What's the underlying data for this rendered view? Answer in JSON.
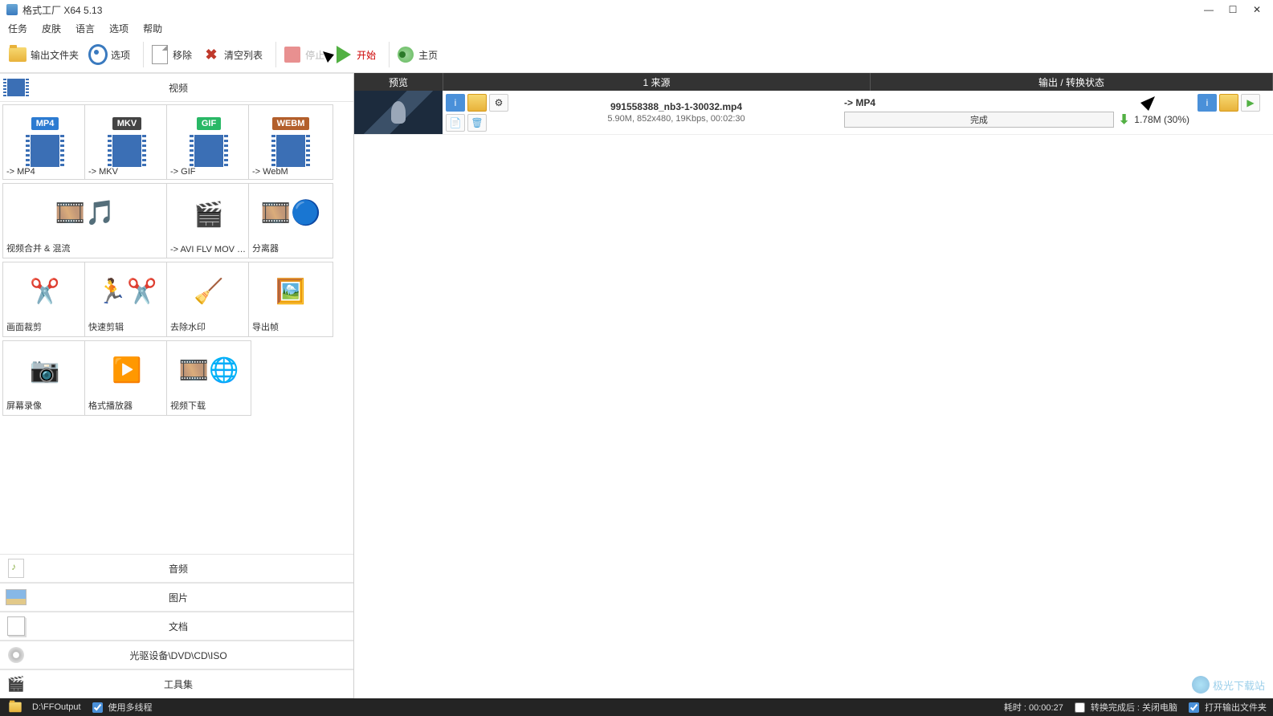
{
  "window": {
    "title": "格式工厂 X64 5.13"
  },
  "menubar": [
    "任务",
    "皮肤",
    "语言",
    "选项",
    "帮助"
  ],
  "toolbar": {
    "output_folder": "输出文件夹",
    "options": "选项",
    "remove": "移除",
    "clear_list": "清空列表",
    "stop": "停止",
    "start": "开始",
    "homepage": "主页"
  },
  "categories": {
    "video": "视频",
    "audio": "音频",
    "image": "图片",
    "document": "文档",
    "disc": "光驱设备\\DVD\\CD\\ISO",
    "tools": "工具集"
  },
  "video_tiles": [
    {
      "label": "-> MP4",
      "kind": "fmt",
      "cls": "mp4"
    },
    {
      "label": "-> MKV",
      "kind": "fmt",
      "cls": "mkv"
    },
    {
      "label": "-> GIF",
      "kind": "fmt",
      "cls": "gif"
    },
    {
      "label": "-> WebM",
      "kind": "fmt",
      "cls": "webm"
    },
    {
      "label": "视频合并 & 混流",
      "kind": "emoji",
      "icon": "🎞️🎵",
      "wide": true
    },
    {
      "label": "-> AVI FLV MOV Etc...",
      "kind": "emoji",
      "icon": "🎬"
    },
    {
      "label": "分离器",
      "kind": "emoji",
      "icon": "🎞️🔵"
    },
    {
      "label": "画面裁剪",
      "kind": "emoji",
      "icon": "✂️"
    },
    {
      "label": "快速剪辑",
      "kind": "emoji",
      "icon": "🏃✂️"
    },
    {
      "label": "去除水印",
      "kind": "emoji",
      "icon": "🧹"
    },
    {
      "label": "导出帧",
      "kind": "emoji",
      "icon": "🖼️"
    },
    {
      "label": "屏幕录像",
      "kind": "emoji",
      "icon": "📷"
    },
    {
      "label": "格式播放器",
      "kind": "emoji",
      "icon": "▶️"
    },
    {
      "label": "视频下载",
      "kind": "emoji",
      "icon": "🎞️🌐"
    }
  ],
  "list_header": {
    "preview": "预览",
    "source_prefix": "1 来源",
    "output": "输出 / 转换状态"
  },
  "tasks": [
    {
      "name": "991558388_nb3-1-30032.mp4",
      "info": "5.90M, 852x480, 19Kbps, 00:02:30",
      "output_format": "-> MP4",
      "progress_text": "完成",
      "result_size": "1.78M (30%)"
    }
  ],
  "statusbar": {
    "output_path": "D:\\FFOutput",
    "multithread_label": "使用多线程",
    "elapsed": "耗时 : 00:00:27",
    "after_convert_label": "转换完成后 : 关闭电脑",
    "open_output_label": "打开输出文件夹"
  },
  "watermark": "极光下载站"
}
